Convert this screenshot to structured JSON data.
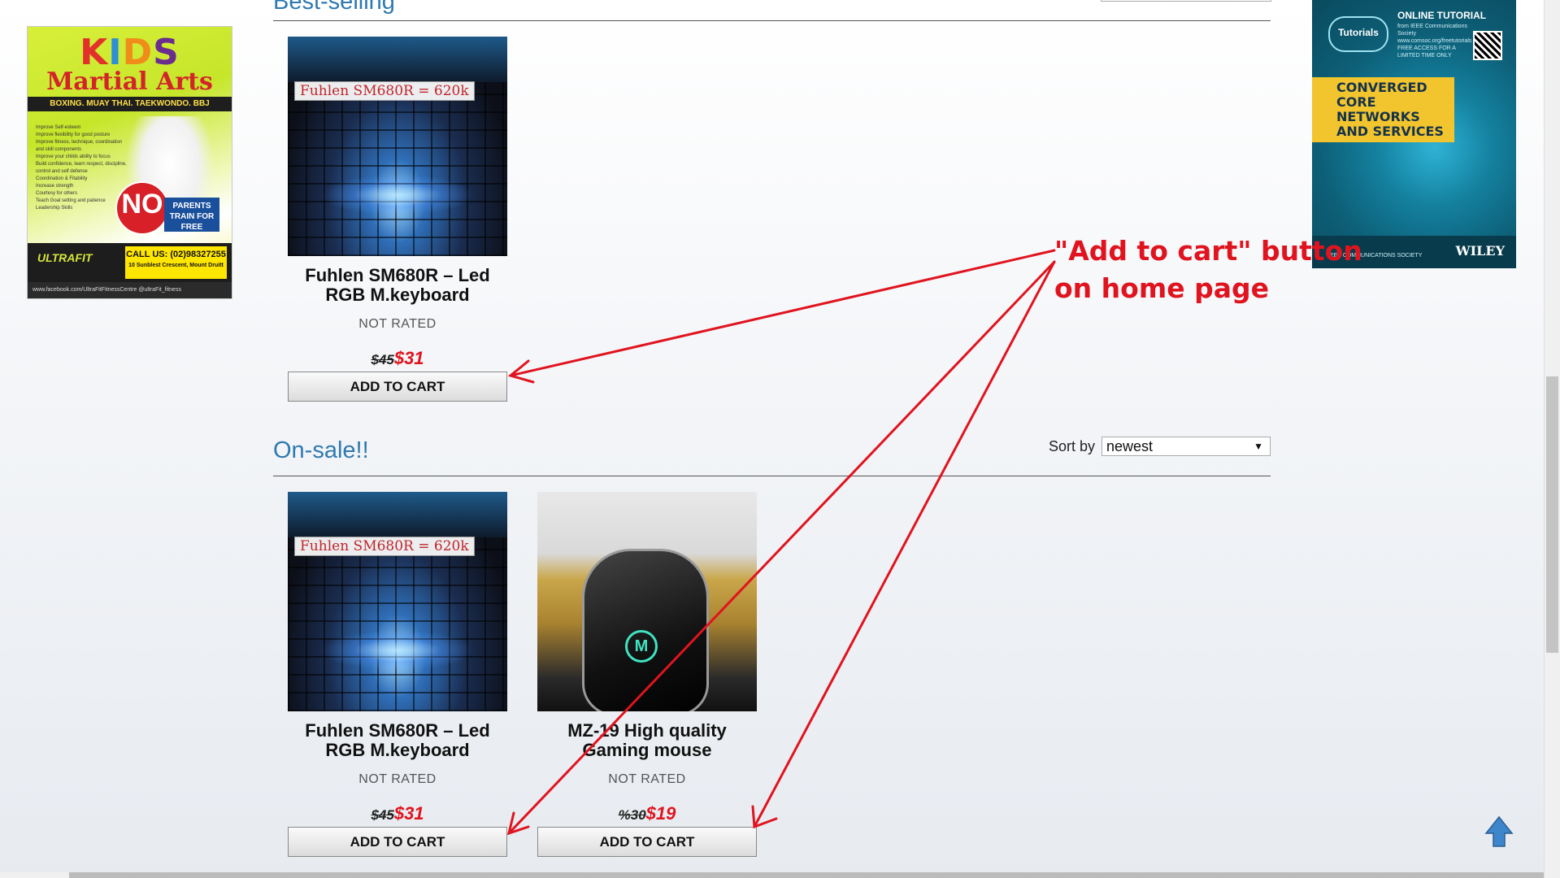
{
  "ads": {
    "left": {
      "kids": [
        "K",
        "I",
        "D",
        "S"
      ],
      "title": "Martial Arts",
      "disciplines": "BOXING. MUAY THAI. TAEKWONDO. BBJ",
      "bullets": [
        "Improve Self-esteem",
        "Improve flexibility for good posture",
        "Improve fitness, technique, coordination and skill components",
        "Improve your childs ability to focus",
        "Build confidence, learn respect, discipline, control and self defense",
        "Coordination & Fitability",
        "Increase strength",
        "Courtesy for others",
        "Teach Goal setting and patience",
        "Leadership Skills"
      ],
      "no_fee": "NO",
      "parents": "PARENTS TRAIN FOR FREE",
      "brand": "ULTRAFIT",
      "call": "CALL US: (02)98327255",
      "address": "10 Sunblest Crescent, Mount Druitt",
      "facebook": "www.facebook.com/UltraFitFitnessCentre   @ultraFit_fitness"
    },
    "right": {
      "brand": "Tutorials",
      "online": "ONLINE TUTORIAL",
      "sub": "from IEEE Communications Society www.comsoc.org/freetutorials FREE ACCESS FOR A LIMITED TIME ONLY",
      "headline": "CONVERGED CORE NETWORKS AND SERVICES",
      "ieee": "IEEE COMMUNICATIONS SOCIETY",
      "publisher": "WILEY"
    }
  },
  "sections": {
    "best_selling": {
      "title": "Best-selling"
    },
    "on_sale": {
      "title": "On-sale!!",
      "sort_label": "Sort by",
      "sort_value": "newest"
    }
  },
  "products": {
    "best_1": {
      "image_label": "Fuhlen SM680R = 620k",
      "name": "Fuhlen SM680R – Led RGB M.keyboard",
      "rating": "NOT RATED",
      "old_price": "$45",
      "new_price": "$31",
      "button": "ADD TO CART"
    },
    "sale_1": {
      "image_label": "Fuhlen SM680R = 620k",
      "name": "Fuhlen SM680R – Led RGB M.keyboard",
      "rating": "NOT RATED",
      "old_price": "$45",
      "new_price": "$31",
      "button": "ADD TO CART"
    },
    "sale_2": {
      "image_label": "M",
      "name": "MZ-19 High quality Gaming mouse",
      "rating": "NOT RATED",
      "old_price": "%30",
      "new_price": "$19",
      "button": "ADD TO CART"
    }
  },
  "annotation": {
    "line1": "\"Add to cart\" button",
    "line2": "on home page",
    "color": "#e0141f"
  },
  "icons": {
    "scroll_top": "up-arrow-icon"
  }
}
